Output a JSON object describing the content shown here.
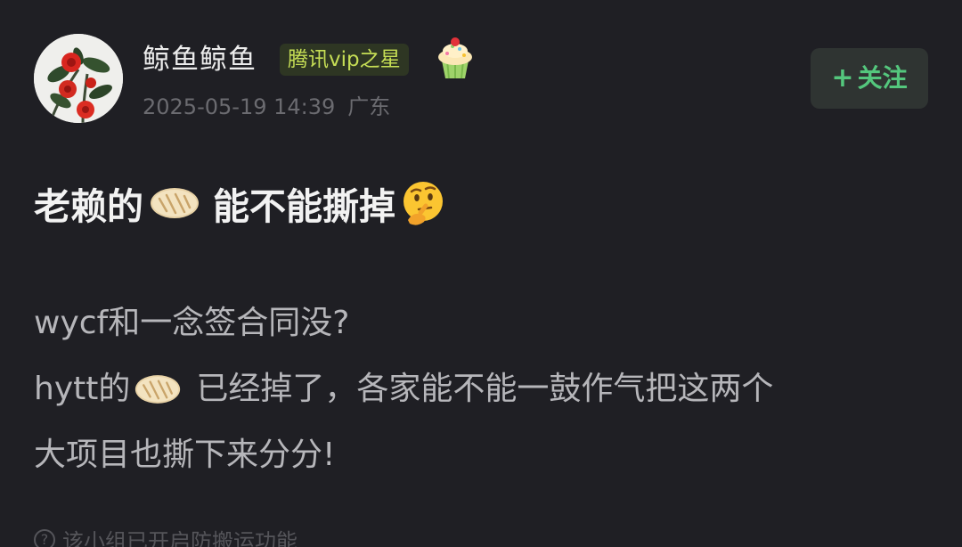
{
  "post": {
    "author": {
      "name": "鲸鱼鲸鱼",
      "badge": "腾讯vip之星",
      "avatar_icon": "red-flowers-avatar",
      "badge_emoji_icon": "cupcake-icon"
    },
    "meta": {
      "datetime": "2025-05-19 14:39",
      "location": "广东"
    },
    "follow_button": {
      "plus": "+",
      "label": "关注"
    },
    "title": {
      "prefix": "老赖的",
      "emoji_icon": "pancake-emoji",
      "suffix": "能不能撕掉",
      "end_emoji_icon": "thinking-face-emoji"
    },
    "body": {
      "line1": "wycf和一念签合同没?",
      "line2_prefix": "hytt的",
      "line2_emoji_icon": "pancake-emoji",
      "line2_suffix": "已经掉了，各家能不能一鼓作气把这两个",
      "line3": "大项目也撕下来分分!"
    },
    "notice": {
      "icon": "question-circle-icon",
      "text": "该小组已开启防搬运功能"
    }
  },
  "colors": {
    "background": "#1f1f24",
    "badge_text": "#c6de55",
    "follow_text": "#54c77d"
  }
}
